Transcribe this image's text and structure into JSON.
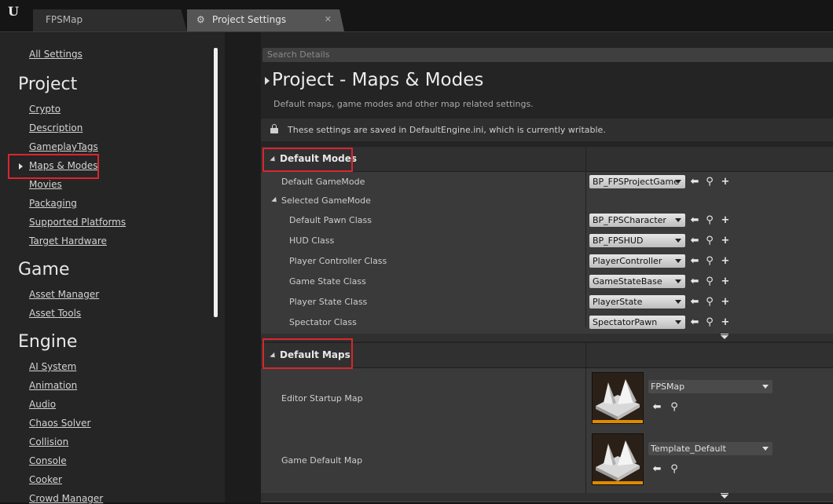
{
  "window": {
    "logo_icon": "unreal-engine-logo",
    "tabs": [
      {
        "label": "FPSMap",
        "active": false
      },
      {
        "label": "Project Settings",
        "active": true,
        "icon": "settings-icon"
      }
    ]
  },
  "sidebar": {
    "all_settings": "All Settings",
    "groups": [
      {
        "title": "Project",
        "items": [
          "Crypto",
          "Description",
          "GameplayTags",
          "Maps & Modes",
          "Movies",
          "Packaging",
          "Supported Platforms",
          "Target Hardware"
        ]
      },
      {
        "title": "Game",
        "items": [
          "Asset Manager",
          "Asset Tools"
        ]
      },
      {
        "title": "Engine",
        "items": [
          "AI System",
          "Animation",
          "Audio",
          "Chaos Solver",
          "Collision",
          "Console",
          "Cooker",
          "Crowd Manager"
        ]
      }
    ],
    "selected": "Maps & Modes"
  },
  "details": {
    "search_placeholder": "Search Details",
    "title": "Project - Maps & Modes",
    "subtitle": "Default maps, game modes and other map related settings.",
    "notice": "These settings are saved in DefaultEngine.ini, which is currently writable.",
    "default_modes": {
      "header": "Default Modes",
      "default_gamemode_label": "Default GameMode",
      "default_gamemode_value": "BP_FPSProjectGame",
      "selected_gamemode_label": "Selected GameMode",
      "rows": [
        {
          "label": "Default Pawn Class",
          "value": "BP_FPSCharacter"
        },
        {
          "label": "HUD Class",
          "value": "BP_FPSHUD"
        },
        {
          "label": "Player Controller Class",
          "value": "PlayerController"
        },
        {
          "label": "Game State Class",
          "value": "GameStateBase"
        },
        {
          "label": "Player State Class",
          "value": "PlayerState"
        },
        {
          "label": "Spectator Class",
          "value": "SpectatorPawn"
        }
      ]
    },
    "default_maps": {
      "header": "Default Maps",
      "rows": [
        {
          "label": "Editor Startup Map",
          "value": "FPSMap"
        },
        {
          "label": "Game Default Map",
          "value": "Template_Default"
        }
      ]
    }
  },
  "colors": {
    "highlight_box": "#d9262e",
    "thumbnail_bar": "#e08a00"
  }
}
